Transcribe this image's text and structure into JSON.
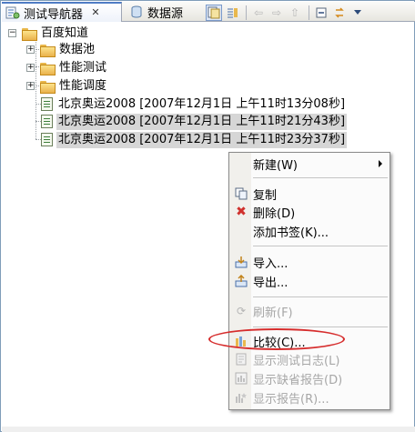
{
  "tabs": [
    {
      "label": "测试导航器",
      "active": true
    },
    {
      "label": "数据源",
      "active": false
    }
  ],
  "toolbar": {
    "icons": [
      "collapse-all-icon",
      "link-editor-icon",
      "back-arrow-icon",
      "forward-arrow-icon",
      "up-arrow-icon",
      "minimize-icon",
      "sync-icon",
      "view-menu-icon"
    ]
  },
  "tree": {
    "root": {
      "label": "百度知道"
    },
    "folders": [
      {
        "label": "数据池"
      },
      {
        "label": "性能测试"
      },
      {
        "label": "性能调度"
      }
    ],
    "results": [
      {
        "label": "北京奥运2008 [2007年12月1日 上午11时13分08秒]",
        "selected": false
      },
      {
        "label": "北京奥运2008 [2007年12月1日 上午11时21分43秒]",
        "selected": true
      },
      {
        "label": "北京奥运2008 [2007年12月1日 上午11时23分37秒]",
        "selected": true
      }
    ]
  },
  "context_menu": {
    "new": "新建(W)",
    "copy": "复制",
    "delete": "删除(D)",
    "add_bookmark": "添加书签(K)...",
    "import": "导入...",
    "export": "导出...",
    "refresh": "刷新(F)",
    "compare": "比较(C)...",
    "show_test_log": "显示测试日志(L)",
    "show_default_report": "显示缺省报告(D)",
    "show_report": "显示报告(R)..."
  },
  "colors": {
    "selection_bg": "#d6d6d6",
    "highlight_ellipse": "#d62d2d",
    "delete_icon": "#d0312d"
  }
}
